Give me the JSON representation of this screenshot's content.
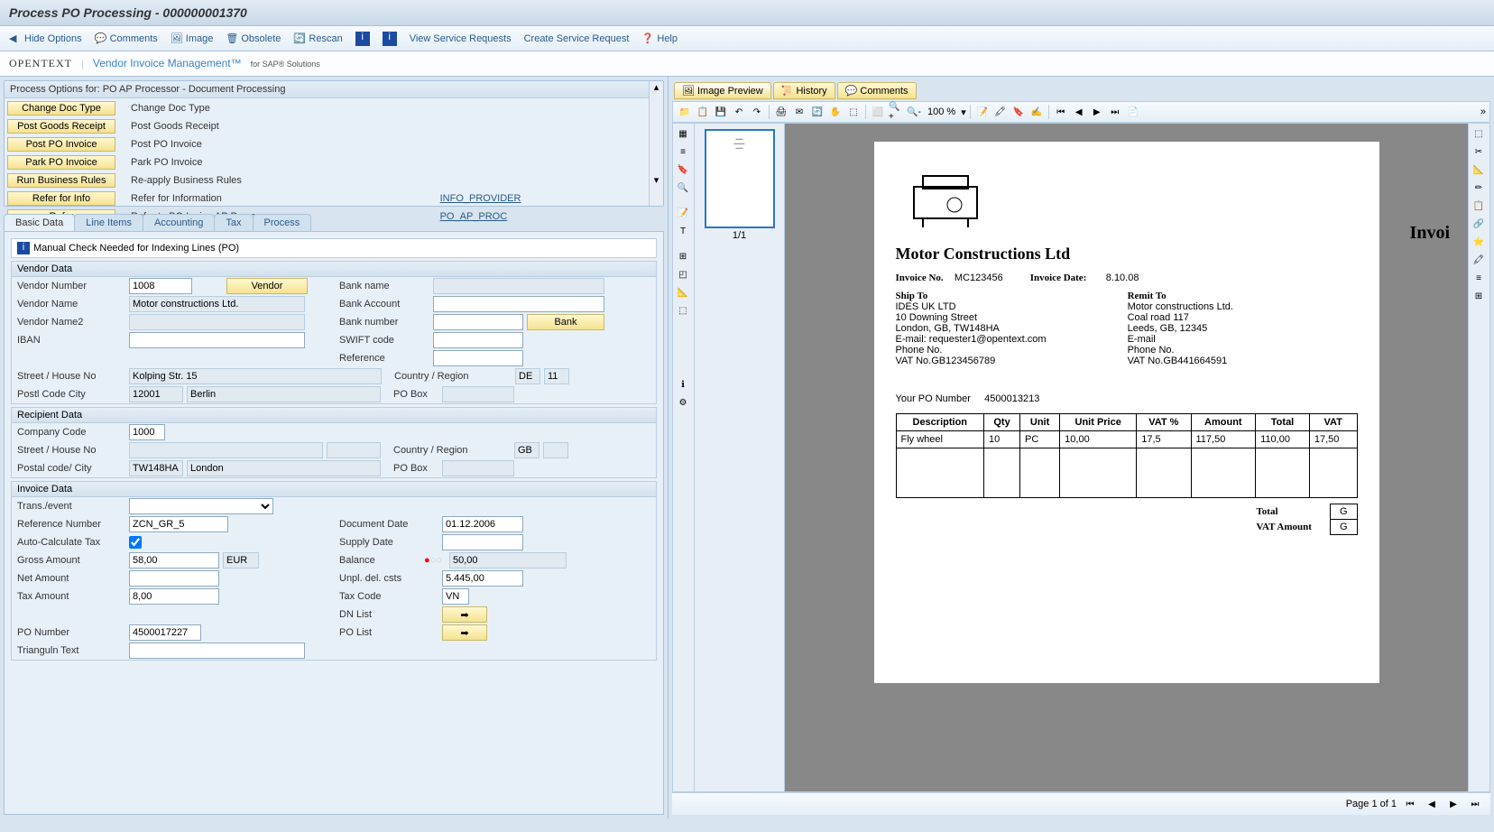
{
  "title": "Process PO Processing - 000000001370",
  "toolbar": {
    "hide_options": "Hide Options",
    "comments": "Comments",
    "image": "Image",
    "obsolete": "Obsolete",
    "rescan": "Rescan",
    "view_service_requests": "View Service Requests",
    "create_service_request": "Create Service Request",
    "help": "Help"
  },
  "branding": {
    "brand": "OPENTEXT",
    "product": "Vendor Invoice Management™",
    "suffix": "for SAP® Solutions"
  },
  "process_options": {
    "title": "Process Options for: PO AP Processor - Document Processing",
    "rows": [
      {
        "btn": "Change Doc Type",
        "desc": "Change Doc Type",
        "code": ""
      },
      {
        "btn": "Post Goods Receipt",
        "desc": "Post Goods Receipt",
        "code": ""
      },
      {
        "btn": "Post PO Invoice",
        "desc": "Post PO Invoice",
        "code": ""
      },
      {
        "btn": "Park PO Invoice",
        "desc": "Park PO Invoice",
        "code": ""
      },
      {
        "btn": "Run Business Rules",
        "desc": "Re-apply Business Rules",
        "code": ""
      },
      {
        "btn": "Refer for Info",
        "desc": "Refer for Information",
        "code": "INFO_PROVIDER"
      },
      {
        "btn": "Refer",
        "desc": "Refer to PO Inoice AP Processor",
        "code": "PO_AP_PROC"
      }
    ]
  },
  "tabs": {
    "basic_data": "Basic Data",
    "line_items": "Line Items",
    "accounting": "Accounting",
    "tax": "Tax",
    "process": "Process"
  },
  "banner": "Manual Check Needed for Indexing Lines (PO)",
  "vendor_data": {
    "title": "Vendor Data",
    "vendor_number_lbl": "Vendor Number",
    "vendor_number": "1008",
    "vendor_btn": "Vendor",
    "vendor_name_lbl": "Vendor Name",
    "vendor_name": "Motor constructions Ltd.",
    "vendor_name2_lbl": "Vendor Name2",
    "vendor_name2": "",
    "iban_lbl": "IBAN",
    "iban": "",
    "bank_name_lbl": "Bank name",
    "bank_name": "",
    "bank_account_lbl": "Bank Account",
    "bank_account": "",
    "bank_number_lbl": "Bank number",
    "bank_number": "",
    "bank_btn": "Bank",
    "swift_lbl": "SWIFT code",
    "swift": "",
    "reference_lbl": "Reference",
    "reference": "",
    "street_lbl": "Street /     House No",
    "street": "Kolping Str. 15",
    "country_lbl": "Country   /     Region",
    "country": "DE",
    "region": "11",
    "post_lbl": "Postl Code       City",
    "post_code": "12001",
    "city": "Berlin",
    "pobox_lbl": "PO Box",
    "pobox": ""
  },
  "recipient_data": {
    "title": "Recipient Data",
    "company_code_lbl": "Company Code",
    "company_code": "1000",
    "street_lbl": "Street /     House No",
    "street": "",
    "country_lbl": "Country   /     Region",
    "country": "GB",
    "region": "",
    "post_lbl": "Postal code/     City",
    "post_code": "TW148HA",
    "city": "London",
    "pobox_lbl": "PO Box",
    "pobox": ""
  },
  "invoice_data": {
    "title": "Invoice Data",
    "trans_lbl": "Trans./event",
    "trans": "",
    "ref_num_lbl": "Reference Number",
    "ref_num": "ZCN_GR_5",
    "doc_date_lbl": "Document Date",
    "doc_date": "01.12.2006",
    "auto_calc_lbl": "Auto-Calculate Tax",
    "supply_date_lbl": "Supply Date",
    "supply_date": "",
    "gross_lbl": "Gross Amount",
    "gross": "58,00",
    "currency": "EUR",
    "balance_lbl": "Balance",
    "balance": "50,00",
    "net_lbl": "Net Amount",
    "net": "",
    "unpl_lbl": "Unpl. del. csts",
    "unpl": "5.445,00",
    "tax_amt_lbl": "Tax Amount",
    "tax_amt": "8,00",
    "tax_code_lbl": "Tax Code",
    "tax_code": "VN",
    "dn_list_lbl": "DN List",
    "po_num_lbl": "PO Number",
    "po_num": "4500017227",
    "po_list_lbl": "PO List",
    "trianguln_lbl": "Trianguln Text",
    "trianguln": ""
  },
  "image_tabs": {
    "preview": "Image Preview",
    "history": "History",
    "comments": "Comments"
  },
  "zoom": "100 %",
  "thumb_label": "1/1",
  "document": {
    "company": "Motor Constructions Ltd",
    "invoice_no_lbl": "Invoice No.",
    "invoice_no": "MC123456",
    "invoice_date_lbl": "Invoice Date:",
    "invoice_date": "8.10.08",
    "invoice_word": "Invoi",
    "ship_to_h": "Ship To",
    "ship_to": [
      "IDES UK LTD",
      "10 Downing Street",
      "London, GB, TW148HA",
      "E-mail: requester1@opentext.com",
      "Phone No.",
      "VAT No.GB123456789"
    ],
    "remit_to_h": "Remit To",
    "remit_to": [
      "Motor constructions Ltd.",
      "Coal road  117",
      "Leeds, GB, 12345",
      "E-mail",
      "Phone No.",
      "VAT No.GB441664591"
    ],
    "po_lbl": "Your PO Number",
    "po_num": "4500013213",
    "headers": [
      "Description",
      "Qty",
      "Unit",
      "Unit Price",
      "VAT %",
      "Amount",
      "Total",
      "VAT"
    ],
    "row": [
      "Fly wheel",
      "10",
      "PC",
      "10,00",
      "17,5",
      "117,50",
      "110,00",
      "17,50"
    ],
    "total_lbl": "Total",
    "total_g": "G",
    "vat_lbl": "VAT Amount",
    "vat_g": "G"
  },
  "statusbar": {
    "page": "Page 1 of 1"
  }
}
